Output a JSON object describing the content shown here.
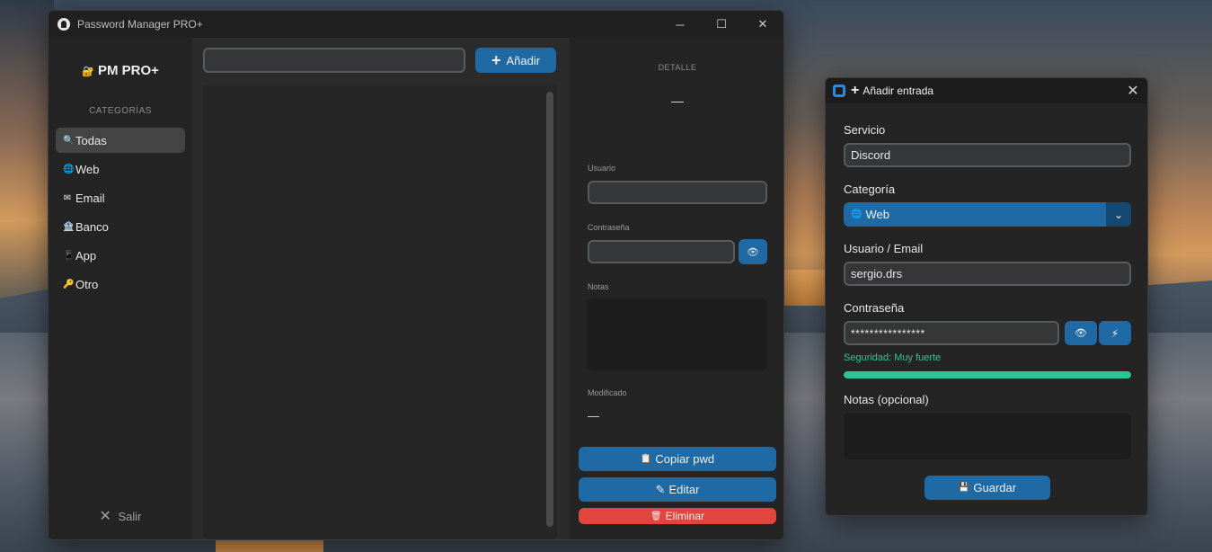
{
  "main": {
    "title": "Password Manager PRO+",
    "brand": "PM PRO+",
    "categories_title": "CATEGORÍAS",
    "categories": [
      {
        "label": "Todas",
        "icon": "🔍"
      },
      {
        "label": "Web",
        "icon": "🌐"
      },
      {
        "label": "Email",
        "icon": "✉"
      },
      {
        "label": "Banco",
        "icon": "🏦"
      },
      {
        "label": "App",
        "icon": "📱"
      },
      {
        "label": "Otro",
        "icon": "🔑"
      }
    ],
    "exit_label": "Salir",
    "add_label": "Añadir",
    "detail": {
      "title": "DETALLE",
      "service": "—",
      "user_label": "Usuario",
      "password_label": "Contraseña",
      "notes_label": "Notas",
      "modified_label": "Modificado",
      "modified_value": "—"
    },
    "actions": {
      "copy": "Copiar pwd",
      "edit": "Editar",
      "delete": "Eliminar"
    }
  },
  "dialog": {
    "title": "Añadir entrada",
    "service_label": "Servicio",
    "service_value": "Discord",
    "category_label": "Categoría",
    "category_value": "Web",
    "user_label": "Usuario / Email",
    "user_value": "sergio.drs",
    "password_label": "Contraseña",
    "password_value": "****************",
    "strength_text": "Seguridad: Muy fuerte",
    "strength_level": 1.0,
    "notes_label": "Notas (opcional)",
    "save_label": "Guardar"
  },
  "colors": {
    "accent": "#1f6aa5",
    "danger": "#e0463e",
    "strength": "#2ec498"
  }
}
